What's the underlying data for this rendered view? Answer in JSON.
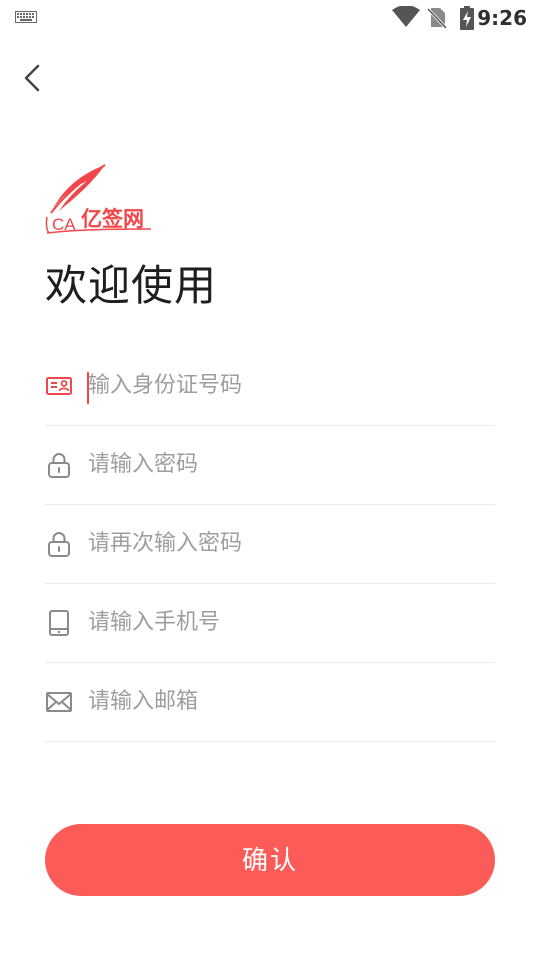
{
  "status_bar": {
    "time": "9:26",
    "icons": [
      "keyboard-icon",
      "wifi-icon",
      "no-sim-icon",
      "battery-charging-icon"
    ]
  },
  "header": {
    "back_icon": "chevron-left-icon"
  },
  "logo": {
    "text": "CA亿签网",
    "brand_color": "#f2464a"
  },
  "welcome": "欢迎使用",
  "form": {
    "fields": [
      {
        "icon": "id-card-icon",
        "placeholder": "输入身份证号码",
        "value": "",
        "focused": true
      },
      {
        "icon": "lock-icon",
        "placeholder": "请输入密码",
        "value": ""
      },
      {
        "icon": "lock-icon",
        "placeholder": "请再次输入密码",
        "value": ""
      },
      {
        "icon": "phone-icon",
        "placeholder": "请输入手机号",
        "value": ""
      },
      {
        "icon": "mail-icon",
        "placeholder": "请输入邮箱",
        "value": ""
      }
    ]
  },
  "confirm_label": "确认",
  "colors": {
    "accent": "#fb5c58",
    "text": "#1e1e1e",
    "placeholder": "#9e9e9e",
    "divider": "#ececec"
  }
}
